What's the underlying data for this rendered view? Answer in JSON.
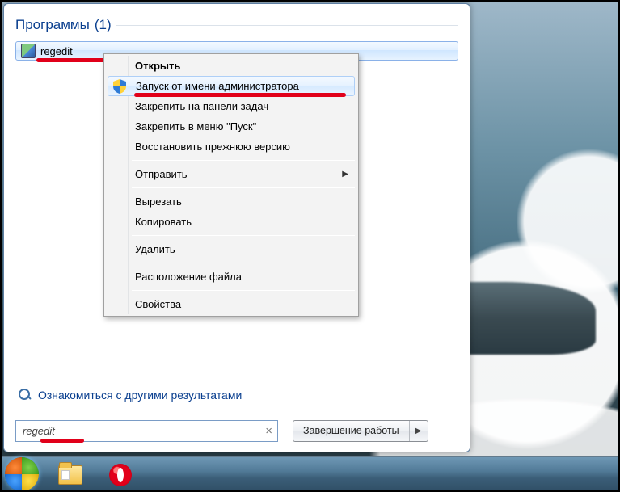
{
  "startPanel": {
    "header": "Программы",
    "count": "(1)",
    "resultLabel": "regedit",
    "moreResults": "Ознакомиться с другими результатами",
    "searchValue": "regedit",
    "shutdownLabel": "Завершение работы"
  },
  "contextMenu": {
    "open": "Открыть",
    "runAsAdmin": "Запуск от имени администратора",
    "pinTaskbar": "Закрепить на панели задач",
    "pinStart": "Закрепить в меню \"Пуск\"",
    "restorePrev": "Восстановить прежнюю версию",
    "sendTo": "Отправить",
    "cut": "Вырезать",
    "copy": "Копировать",
    "delete": "Удалить",
    "fileLocation": "Расположение файла",
    "properties": "Свойства"
  },
  "taskbar": {
    "start": "start",
    "explorer": "explorer",
    "opera": "opera"
  }
}
